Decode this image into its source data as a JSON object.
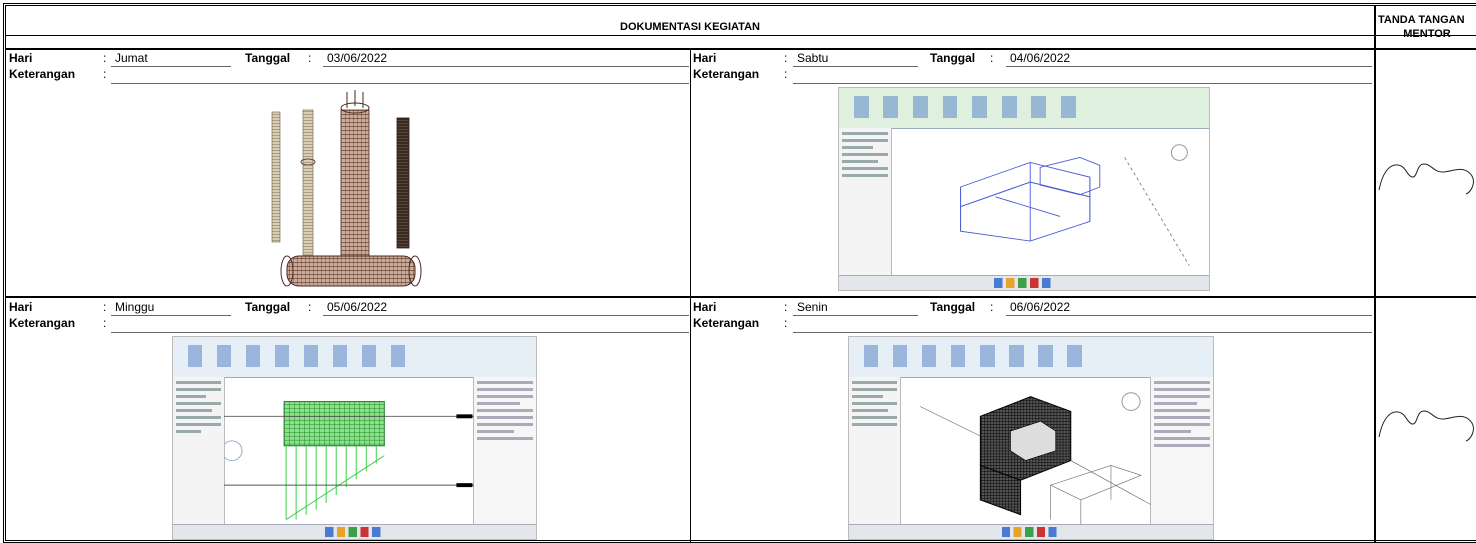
{
  "header": {
    "title": "DOKUMENTASI KEGIATAN",
    "mentor_line1": "TANDA TANGAN",
    "mentor_line2": "MENTOR"
  },
  "labels": {
    "hari": "Hari",
    "tanggal": "Tanggal",
    "keterangan": "Keterangan",
    "colon": ":"
  },
  "entries": [
    {
      "hari": "Jumat",
      "tanggal": "03/06/2022",
      "keterangan": "",
      "image": "rebar-column-cages-3d"
    },
    {
      "hari": "Sabtu",
      "tanggal": "04/06/2022",
      "keterangan": "",
      "image": "revit-wireframe-building-view"
    },
    {
      "hari": "Minggu",
      "tanggal": "05/06/2022",
      "keterangan": "",
      "image": "revit-green-rebar-section-view"
    },
    {
      "hari": "Senin",
      "tanggal": "06/06/2022",
      "keterangan": "",
      "image": "revit-black-rebar-3d-view"
    }
  ],
  "colors": {
    "border": "#000000",
    "rebar": "#6b4a3a",
    "wire": "#4a5bd4",
    "green_rebar": "#3fd04a"
  }
}
